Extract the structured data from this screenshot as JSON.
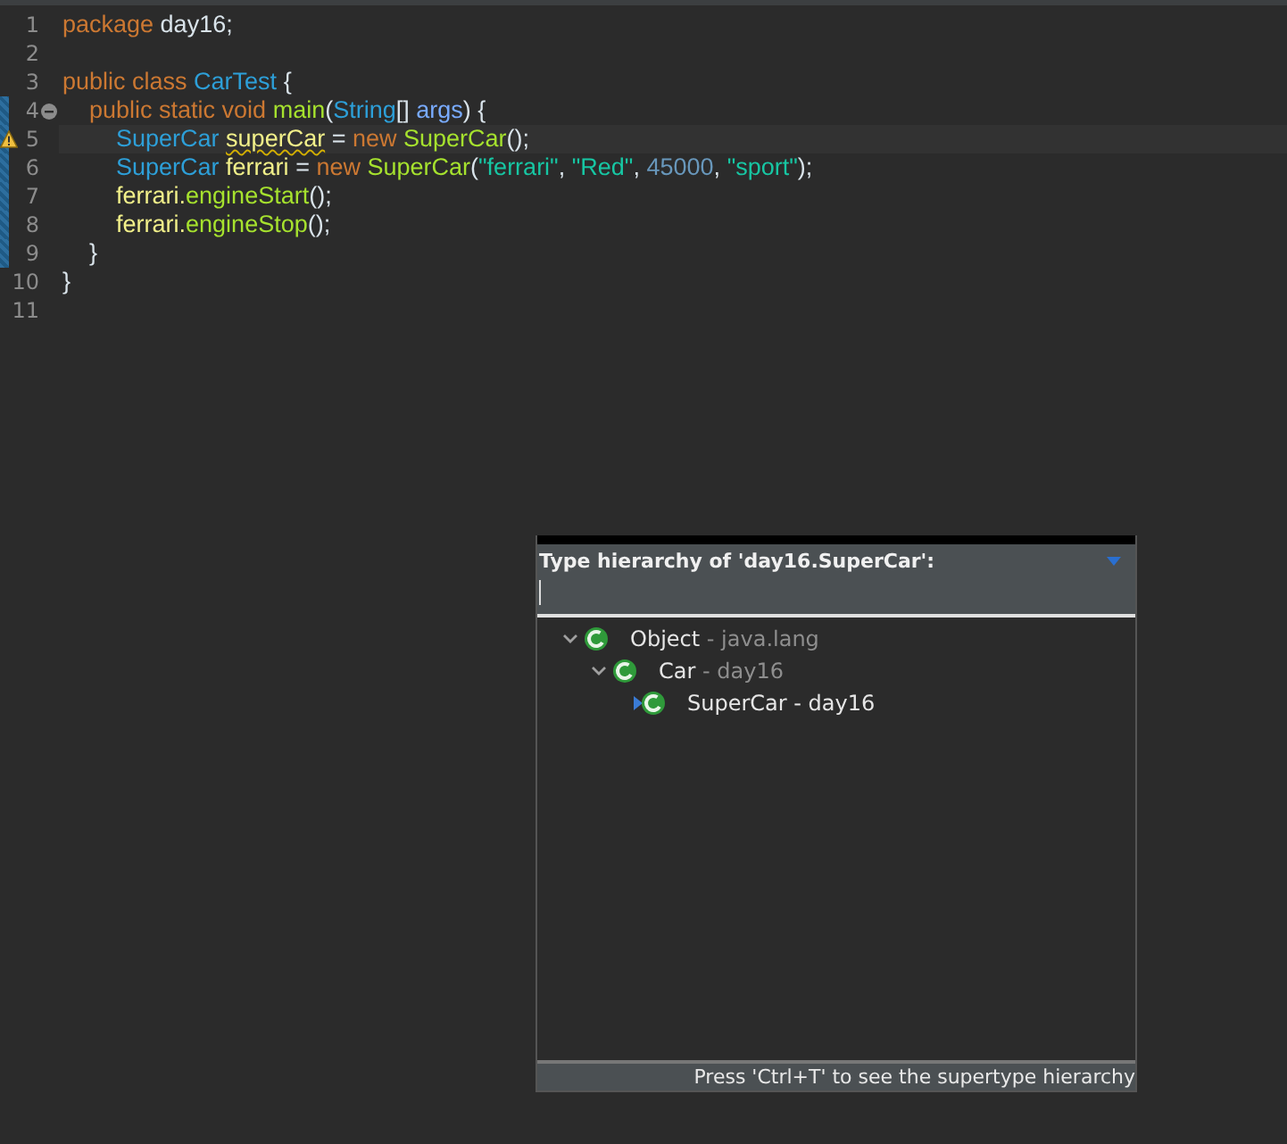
{
  "editor": {
    "lines": [
      {
        "number": "1",
        "tokens": [
          {
            "text": "package",
            "kind": "keyword"
          },
          {
            "text": " day16;",
            "kind": "plain"
          }
        ]
      },
      {
        "number": "2"
      },
      {
        "number": "3",
        "tokens": [
          {
            "text": "public class ",
            "kind": "keyword"
          },
          {
            "text": "CarTest",
            "kind": "type"
          },
          {
            "text": " {",
            "kind": "plain"
          }
        ]
      },
      {
        "number": "4",
        "fold": true,
        "bar": true,
        "tokens": [
          {
            "text": "\tpublic static void ",
            "kind": "keyword"
          },
          {
            "text": "main",
            "kind": "method"
          },
          {
            "text": "(",
            "kind": "plain"
          },
          {
            "text": "String",
            "kind": "type"
          },
          {
            "text": "[] ",
            "kind": "plain"
          },
          {
            "text": "args",
            "kind": "param"
          },
          {
            "text": ") {",
            "kind": "plain"
          }
        ]
      },
      {
        "number": "5",
        "warning": true,
        "bar": true,
        "current": true,
        "tokens": [
          {
            "text": "\t\tSuperCar ",
            "kind": "type"
          },
          {
            "text": "superCar",
            "kind": "var",
            "warn": true
          },
          {
            "text": " = ",
            "kind": "plain"
          },
          {
            "text": "new ",
            "kind": "keyword"
          },
          {
            "text": "SuperCar",
            "kind": "method"
          },
          {
            "text": "();",
            "kind": "plain"
          }
        ]
      },
      {
        "number": "6",
        "bar": true,
        "tokens": [
          {
            "text": "\t\tSuperCar ",
            "kind": "type"
          },
          {
            "text": "ferrari",
            "kind": "var"
          },
          {
            "text": " = ",
            "kind": "plain"
          },
          {
            "text": "new ",
            "kind": "keyword"
          },
          {
            "text": "SuperCar",
            "kind": "method"
          },
          {
            "text": "(",
            "kind": "plain"
          },
          {
            "text": "\"ferrari\"",
            "kind": "string"
          },
          {
            "text": ", ",
            "kind": "plain"
          },
          {
            "text": "\"Red\"",
            "kind": "string"
          },
          {
            "text": ", ",
            "kind": "plain"
          },
          {
            "text": "45000",
            "kind": "number"
          },
          {
            "text": ", ",
            "kind": "plain"
          },
          {
            "text": "\"sport\"",
            "kind": "string"
          },
          {
            "text": ");",
            "kind": "plain"
          }
        ]
      },
      {
        "number": "7",
        "bar": true,
        "tokens": [
          {
            "text": "\t\tferrari.",
            "kind": "var"
          },
          {
            "text": "engineStart",
            "kind": "method"
          },
          {
            "text": "();",
            "kind": "plain"
          }
        ]
      },
      {
        "number": "8",
        "bar": true,
        "tokens": [
          {
            "text": "\t\tferrari.",
            "kind": "var"
          },
          {
            "text": "engineStop",
            "kind": "method"
          },
          {
            "text": "();",
            "kind": "plain"
          }
        ]
      },
      {
        "number": "9",
        "bar": true,
        "tokens": [
          {
            "text": "\t}",
            "kind": "plain"
          }
        ]
      },
      {
        "number": "10",
        "tokens": [
          {
            "text": "}",
            "kind": "plain"
          }
        ]
      },
      {
        "number": "11"
      }
    ]
  },
  "hierarchy_popup": {
    "title": "Type hierarchy of 'day16.SuperCar':",
    "tree": [
      {
        "name": "Object",
        "package": "- java.lang",
        "expanded": true,
        "children": [
          {
            "name": "Car",
            "package": "- day16",
            "expanded": true,
            "children": [
              {
                "name": "SuperCar - day16",
                "focus": true
              }
            ]
          }
        ]
      }
    ],
    "status": "Press 'Ctrl+T' to see the supertype hierarchy"
  }
}
